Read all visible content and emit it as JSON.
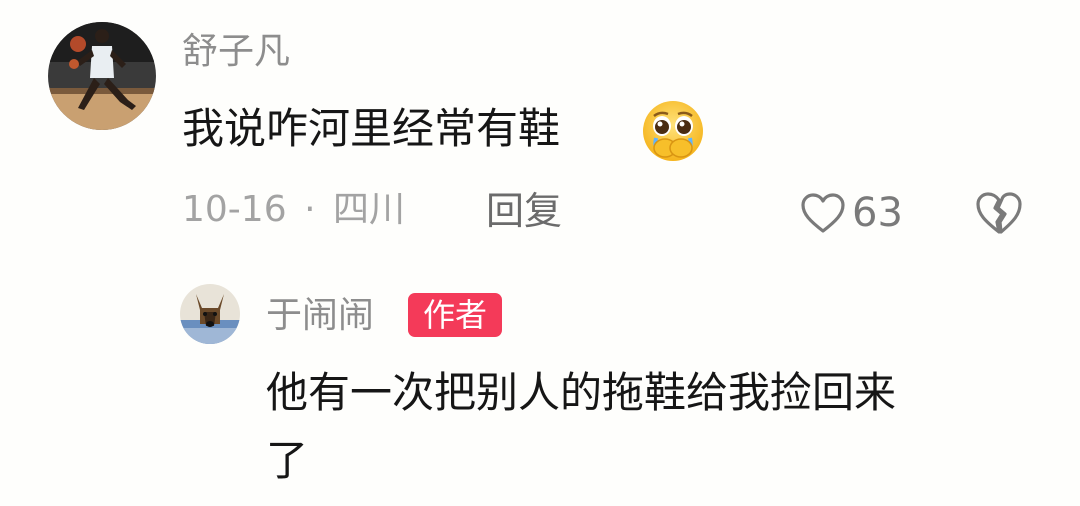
{
  "comment": {
    "username": "舒子凡",
    "text": "我说咋河里经常有鞋",
    "emoji_icon": "pleading-face-emoji",
    "date": "10-16",
    "separator": "·",
    "location": "四川",
    "reply_label": "回复",
    "like_count": "63"
  },
  "reply": {
    "username": "于闹闹",
    "badge": "作者",
    "text_line1": "他有一次把别人的拖鞋给我捡回来",
    "text_line2": "了"
  },
  "colors": {
    "badge_bg": "#f43a59",
    "username": "#8d8d8d",
    "meta": "#a3a3a3"
  }
}
